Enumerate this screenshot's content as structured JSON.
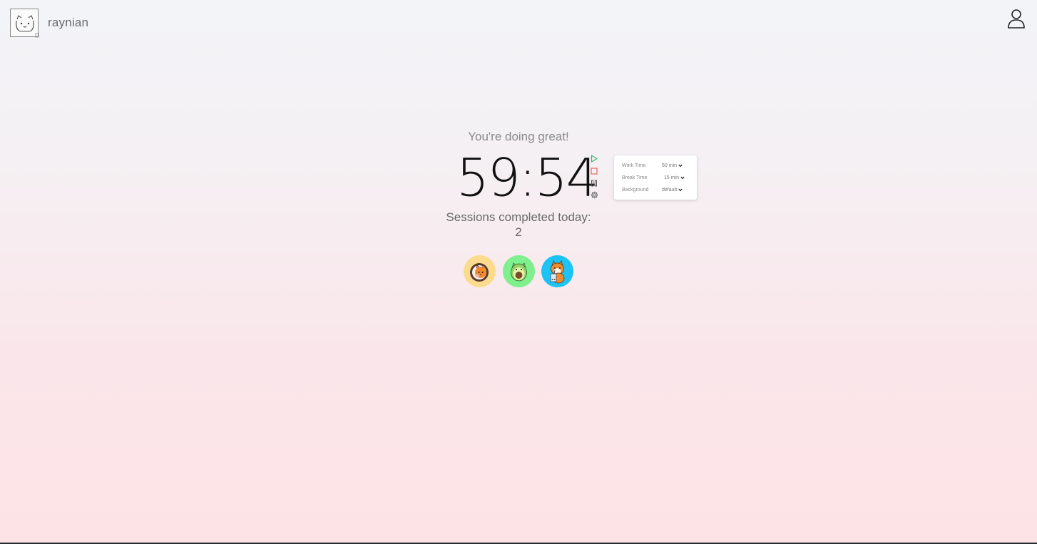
{
  "header": {
    "brand_name": "raynian",
    "logo_icon": "cat-face-logo",
    "profile_icon": "user-icon"
  },
  "timer": {
    "encouragement": "You're doing great!",
    "time": "59:54",
    "sessions_label": "Sessions completed today:",
    "sessions_count": "2"
  },
  "controls": [
    {
      "name": "play-icon",
      "color": "#3cb371"
    },
    {
      "name": "stop-icon",
      "color": "#e06666"
    },
    {
      "name": "pause-icon",
      "color": "#555555"
    },
    {
      "name": "gear-icon",
      "color": "#555555"
    }
  ],
  "settings": {
    "work_time": {
      "label": "Work Time",
      "value": "50 min"
    },
    "break_time": {
      "label": "Break Time",
      "value": "15 min"
    },
    "background": {
      "label": "Background",
      "value": "default"
    }
  },
  "avatars": [
    {
      "name": "cat-in-sushi-avatar",
      "bg": "#fbdc8e"
    },
    {
      "name": "cat-avocado-avatar",
      "bg": "#7ef08e"
    },
    {
      "name": "shiba-boba-avatar",
      "bg": "#1ec3f5"
    }
  ]
}
